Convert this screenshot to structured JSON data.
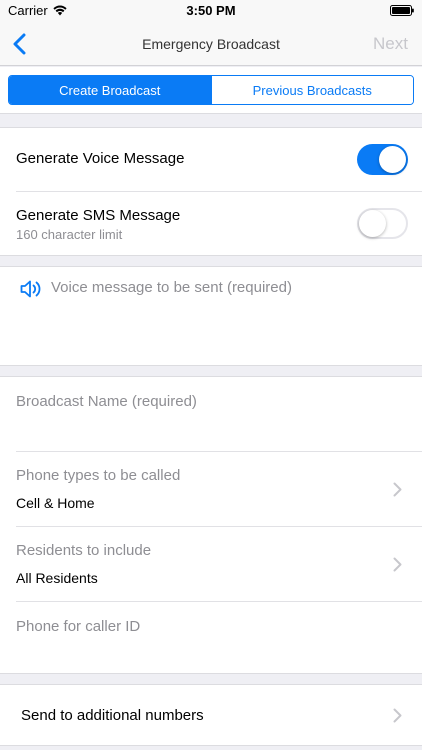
{
  "status_bar": {
    "carrier": "Carrier",
    "time": "3:50 PM"
  },
  "nav": {
    "title": "Emergency Broadcast",
    "next_label": "Next"
  },
  "tabs": {
    "create": "Create Broadcast",
    "previous": "Previous Broadcasts"
  },
  "toggles": {
    "voice": {
      "label": "Generate Voice Message",
      "on": true
    },
    "sms": {
      "label": "Generate SMS Message",
      "sublabel": "160 character limit",
      "on": false
    }
  },
  "voice_message": {
    "placeholder": "Voice message to be sent (required)"
  },
  "form": {
    "broadcast_name": {
      "placeholder": "Broadcast Name (required)"
    },
    "phone_types": {
      "label": "Phone types to be called",
      "value": "Cell & Home"
    },
    "residents": {
      "label": "Residents to include",
      "value": "All Residents"
    },
    "caller_id": {
      "placeholder": "Phone for caller ID"
    }
  },
  "additional": {
    "label": "Send to additional numbers"
  },
  "colors": {
    "accent": "#0a7bf5",
    "background": "#efeff4",
    "placeholder": "#8e8e93"
  }
}
